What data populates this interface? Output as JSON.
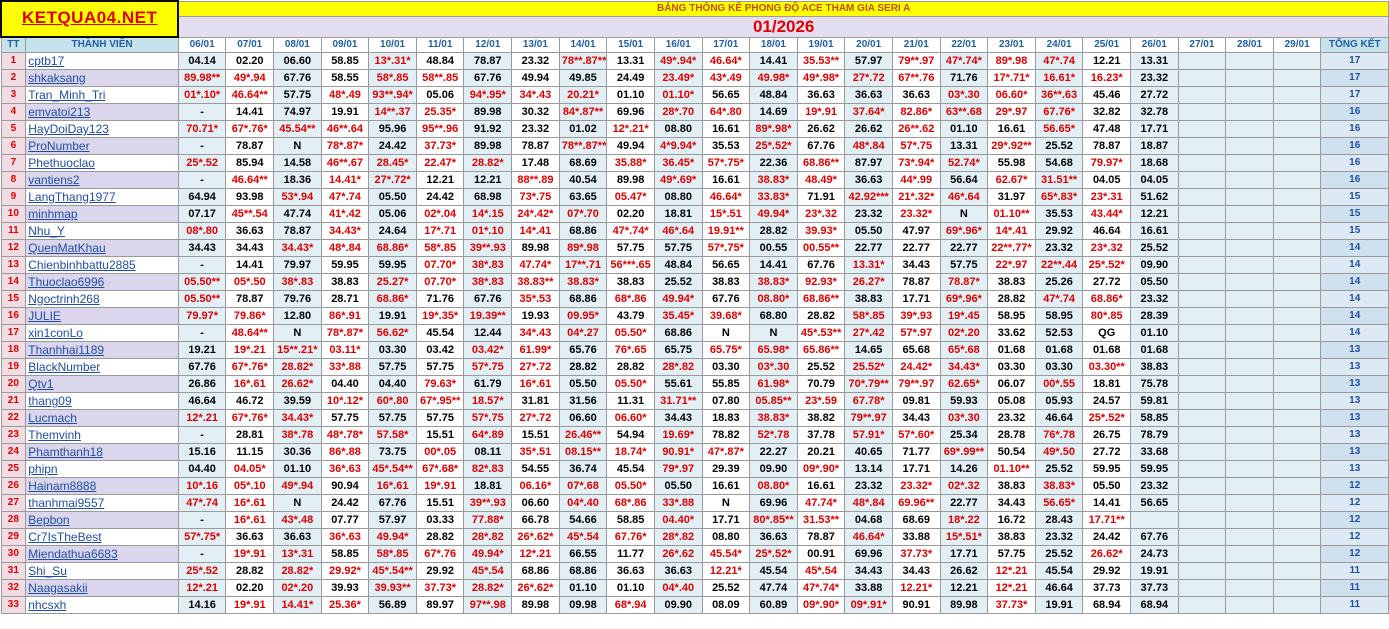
{
  "logo": "KETQUA04.NET",
  "banner": "BẢNG THỐNG KÊ PHONG ĐỘ ACE THAM GIA SERI A",
  "month": "01/2026",
  "headers": {
    "tt": "TT",
    "member": "THÀNH VIÊN",
    "dates": [
      "06/01",
      "07/01",
      "08/01",
      "09/01",
      "10/01",
      "11/01",
      "12/01",
      "13/01",
      "14/01",
      "15/01",
      "16/01",
      "17/01",
      "18/01",
      "19/01",
      "20/01",
      "21/01",
      "22/01",
      "23/01",
      "24/01",
      "25/01",
      "26/01",
      "27/01",
      "28/01",
      "29/01"
    ],
    "total": "TỔNG KẾT"
  },
  "rows": [
    {
      "tt": "1",
      "name": "cptb17",
      "cells": [
        "04.14",
        "02.20",
        "06.60",
        "58.85",
        "13*.31*",
        "48.84",
        "78.87",
        "23.32",
        "78**.87**",
        "13.31",
        "49*.94*",
        "46.64*",
        "14.41",
        "35.53**",
        "57.97",
        "79**.97",
        "47*.74*",
        "89*.98",
        "47*.74",
        "12.21",
        "13.31"
      ],
      "total": "17"
    },
    {
      "tt": "2",
      "name": "shkaksang",
      "cells": [
        "89.98**",
        "49*.94",
        "67.76",
        "58.55",
        "58*.85",
        "58**.85",
        "67.76",
        "49.94",
        "49.85",
        "24.49",
        "23.49*",
        "43*.49",
        "49.98*",
        "49*.98*",
        "27*.72",
        "67**.76",
        "71.76",
        "17*.71*",
        "16.61*",
        "16.23*",
        "23.32"
      ],
      "total": "17"
    },
    {
      "tt": "3",
      "name": "Tran_Minh_Tri",
      "cells": [
        "01*.10*",
        "46.64**",
        "57.75",
        "48*.49",
        "93**.94*",
        "05.06",
        "94*.95*",
        "34*.43",
        "20.21*",
        "01.10",
        "01.10*",
        "56.65",
        "48.84",
        "36.63",
        "36.63",
        "36.63",
        "03*.30",
        "06.60*",
        "36**.63",
        "45.46",
        "27.72"
      ],
      "total": "17"
    },
    {
      "tt": "4",
      "name": "emvatoi213",
      "cells": [
        "-",
        "14.41",
        "74.97",
        "19.91",
        "14**.37",
        "25.35*",
        "89.98",
        "30.32",
        "84*.87**",
        "69.96",
        "28*.70",
        "64*.80",
        "14.69",
        "19*.91",
        "37.64*",
        "82.86*",
        "63**.68",
        "29*.97",
        "67.76*",
        "32.82",
        "32.78"
      ],
      "total": "16"
    },
    {
      "tt": "5",
      "name": "HayDoiDay123",
      "cells": [
        "70.71*",
        "67*.76*",
        "45.54**",
        "46**.64",
        "95.96",
        "95**.96",
        "91.92",
        "23.32",
        "01.02",
        "12*.21*",
        "08.80",
        "16.61",
        "89*.98*",
        "26.62",
        "26.62",
        "26**.62",
        "01.10",
        "16.61",
        "56.65*",
        "47.48",
        "17.71"
      ],
      "total": "16"
    },
    {
      "tt": "6",
      "name": "ProNumber",
      "cells": [
        "-",
        "78.87",
        "N",
        "78*.87*",
        "24.42",
        "37.73*",
        "89.98",
        "78.87",
        "78**.87**",
        "49.94",
        "4*9.94*",
        "35.53",
        "25*.52*",
        "67.76",
        "48*.84",
        "57*.75",
        "13.31",
        "29*.92**",
        "25.52",
        "78.87",
        "18.87"
      ],
      "total": "16"
    },
    {
      "tt": "7",
      "name": "Phethuoclao",
      "cells": [
        "25*.52",
        "85.94",
        "14.58",
        "46**.67",
        "28.45*",
        "22.47*",
        "28.82*",
        "17.48",
        "68.69",
        "35.88*",
        "36.45*",
        "57*.75*",
        "22.36",
        "68.86**",
        "87.97",
        "73*.94*",
        "52.74*",
        "55.98",
        "54.68",
        "79.97*",
        "18.68"
      ],
      "total": "16"
    },
    {
      "tt": "8",
      "name": "vantiens2",
      "cells": [
        "-",
        "46.64**",
        "18.36",
        "14.41*",
        "27*.72*",
        "12.21",
        "12.21",
        "88**.89",
        "40.54",
        "89.98",
        "49*.69*",
        "16.61",
        "38.83*",
        "48.49*",
        "36.63",
        "44*.99",
        "56.64",
        "62.67*",
        "31.51**",
        "04.05",
        "04.05"
      ],
      "total": "16"
    },
    {
      "tt": "9",
      "name": "LangThang1977",
      "cells": [
        "64.94",
        "93.98",
        "53*.94",
        "47*.74",
        "05.50",
        "24.42",
        "68.98",
        "73*.75",
        "63.65",
        "05.47*",
        "08.80",
        "46.64*",
        "33.83*",
        "71.91",
        "42.92***",
        "21*.32*",
        "46*.64",
        "31.97",
        "65*.83*",
        "23*.31",
        "51.62"
      ],
      "total": "15"
    },
    {
      "tt": "10",
      "name": "minhmap",
      "cells": [
        "07.17",
        "45**.54",
        "47.74",
        "41*.42",
        "05.06",
        "02*.04",
        "14*.15",
        "24*.42*",
        "07*.70",
        "02.20",
        "18.81",
        "15*.51",
        "49.94*",
        "23*.32",
        "23.32",
        "23.32*",
        "N",
        "01.10**",
        "35.53",
        "43.44*",
        "12.21"
      ],
      "total": "15"
    },
    {
      "tt": "11",
      "name": "Nhu_Y",
      "cells": [
        "08*.80",
        "36.63",
        "78.87",
        "34.43*",
        "24.64",
        "17*.71",
        "01*.10",
        "14*.41",
        "68.86",
        "47*.74*",
        "46*.64",
        "19.91**",
        "28.82",
        "39.93*",
        "05.50",
        "47.97",
        "69*.96*",
        "14*.41",
        "29.92",
        "46.64",
        "16.61"
      ],
      "total": "15"
    },
    {
      "tt": "12",
      "name": "QuenMatKhau",
      "cells": [
        "34.43",
        "34.43",
        "34.43*",
        "48*.84",
        "68.86*",
        "58*.85",
        "39**.93",
        "89.98",
        "89*.98",
        "57.75",
        "57.75",
        "57*.75*",
        "00.55",
        "00.55**",
        "22.77",
        "22.77",
        "22.77",
        "22**.77*",
        "23.32",
        "23*.32",
        "25.52"
      ],
      "total": "14"
    },
    {
      "tt": "13",
      "name": "Chienbinhbattu2885",
      "cells": [
        "-",
        "14.41",
        "79.97",
        "59.95",
        "59.95",
        "07.70*",
        "38*.83",
        "47.74*",
        "17**.71",
        "56***.65",
        "48.84",
        "56.65",
        "14.41",
        "67.76",
        "13.31*",
        "34.43",
        "57.75",
        "22*.97",
        "22**.44",
        "25*.52*",
        "09.90"
      ],
      "total": "14"
    },
    {
      "tt": "14",
      "name": "Thuoclao6996",
      "cells": [
        "05.50**",
        "05*.50",
        "38*.83",
        "38.83",
        "25.27*",
        "07.70*",
        "38*.83",
        "38.83**",
        "38.83*",
        "38.83",
        "25.52",
        "38.83",
        "38.83*",
        "92.93*",
        "26.27*",
        "78.87",
        "78.87*",
        "38.83",
        "25.26",
        "27.72",
        "05.50"
      ],
      "total": "14"
    },
    {
      "tt": "15",
      "name": "Ngoctrinh268",
      "cells": [
        "05.50**",
        "78.87",
        "79.76",
        "28.71",
        "68.86*",
        "71.76",
        "67.76",
        "35*.53",
        "68.86",
        "68*.86",
        "49.94*",
        "67.76",
        "08.80*",
        "68.86**",
        "38.83",
        "17.71",
        "69*.96*",
        "28.82",
        "47*.74",
        "68.86*",
        "23.32"
      ],
      "total": "14"
    },
    {
      "tt": "16",
      "name": "JULIE",
      "cells": [
        "79.97*",
        "79.86*",
        "12.80",
        "86*.91",
        "19.91",
        "19*.35*",
        "19.39**",
        "19.93",
        "09.95*",
        "43.79",
        "35.45*",
        "39.68*",
        "68.80",
        "28.82",
        "58*.85",
        "39*.93",
        "19*.45",
        "58.95",
        "58.95",
        "80*.85",
        "28.39"
      ],
      "total": "14"
    },
    {
      "tt": "17",
      "name": "xin1conLo",
      "cells": [
        "-",
        "48.64**",
        "N",
        "78*.87*",
        "56.62*",
        "45.54",
        "12.44",
        "34*.43",
        "04*.27",
        "05.50*",
        "68.86",
        "N",
        "N",
        "45*.53**",
        "27*.42",
        "57*.97",
        "02*.20",
        "33.62",
        "52.53",
        "QG",
        "01.10"
      ],
      "total": "14"
    },
    {
      "tt": "18",
      "name": "Thanhhai1189",
      "cells": [
        "19.21",
        "19*.21",
        "15**.21*",
        "03.11*",
        "03.30",
        "03.42",
        "03.42*",
        "61.99*",
        "65.76",
        "76*.65",
        "65.75",
        "65.75*",
        "65.98*",
        "65.86**",
        "14.65",
        "65.68",
        "65*.68",
        "01.68",
        "01.68",
        "01.68",
        "01.68"
      ],
      "total": "13"
    },
    {
      "tt": "19",
      "name": "BlackNumber",
      "cells": [
        "67.76",
        "67*.76*",
        "28.82*",
        "33*.88",
        "57.75",
        "57.75",
        "57*.75",
        "27*.72",
        "28.82",
        "28.82",
        "28*.82",
        "03.30",
        "03*.30",
        "25.52",
        "25.52*",
        "24.42*",
        "34.43*",
        "03.30",
        "03.30",
        "03.30**",
        "38.83"
      ],
      "total": "13"
    },
    {
      "tt": "20",
      "name": "Qtv1",
      "cells": [
        "26.86",
        "16*.61",
        "26.62*",
        "04.40",
        "04.40",
        "79.63*",
        "61.79",
        "16*.61",
        "05.50",
        "05.50*",
        "55.61",
        "55.85",
        "61.98*",
        "70.79",
        "70*.79**",
        "79**.97",
        "62.65*",
        "06.07",
        "00*.55",
        "18.81",
        "75.78"
      ],
      "total": "13"
    },
    {
      "tt": "21",
      "name": "thang09",
      "cells": [
        "46.64",
        "46.72",
        "39.59",
        "10*.12*",
        "60*.80",
        "67*.95**",
        "18.57*",
        "31.81",
        "31.56",
        "11.31",
        "31.71**",
        "07.80",
        "05.85**",
        "23*.59",
        "67.78*",
        "09.81",
        "59.93",
        "05.08",
        "05.93",
        "24.57",
        "59.81"
      ],
      "total": "13"
    },
    {
      "tt": "22",
      "name": "Lucmach",
      "cells": [
        "12*.21",
        "67*.76*",
        "34.43*",
        "57.75",
        "57.75",
        "57.75",
        "57*.75",
        "27*.72",
        "06.60",
        "06.60*",
        "34.43",
        "18.83",
        "38.83*",
        "38.82",
        "79**.97",
        "34.43",
        "03*.30",
        "23.32",
        "46.64",
        "25*.52*",
        "58.85"
      ],
      "total": "13"
    },
    {
      "tt": "23",
      "name": "Themvinh",
      "cells": [
        "-",
        "28.81",
        "38*.78",
        "48*.78*",
        "57.58*",
        "15.51",
        "64*.89",
        "15.51",
        "26.46**",
        "54.94",
        "19.69*",
        "78.82",
        "52*.78",
        "37.78",
        "57.91*",
        "57*.60*",
        "25.34",
        "28.78",
        "76*.78",
        "26.75",
        "78.79"
      ],
      "total": "13"
    },
    {
      "tt": "24",
      "name": "Phamthanh18",
      "cells": [
        "15.16",
        "11.15",
        "30.36",
        "86*.88",
        "73.75",
        "00*.05",
        "08.11",
        "35*.51",
        "08.15**",
        "18.74*",
        "90.91*",
        "47*.87*",
        "22.27",
        "20.21",
        "40.65",
        "71.77",
        "69*.99**",
        "50.54",
        "49*.50",
        "27.72",
        "33.68"
      ],
      "total": "13"
    },
    {
      "tt": "25",
      "name": "phipn",
      "cells": [
        "04.40",
        "04.05*",
        "01.10",
        "36*.63",
        "45*.54**",
        "67*.68*",
        "82*.83",
        "54.55",
        "36.74",
        "45.54",
        "79*.97",
        "29.39",
        "09.90",
        "09*.90*",
        "13.14",
        "17.71",
        "14.26",
        "01.10**",
        "25.52",
        "59.95",
        "59.95"
      ],
      "total": "13"
    },
    {
      "tt": "26",
      "name": "Hainam8888",
      "cells": [
        "10*.16",
        "05*.10",
        "49*.94",
        "90.94",
        "16*.61",
        "19*.91",
        "18.81",
        "06.16*",
        "07*.68",
        "05.50*",
        "05.50",
        "16.61",
        "08.80*",
        "16.61",
        "23.32",
        "23.32*",
        "02*.32",
        "38.83",
        "38.83*",
        "05.50",
        "23.32"
      ],
      "total": "12"
    },
    {
      "tt": "27",
      "name": "thanhmai9557",
      "cells": [
        "47*.74",
        "16*.61",
        "N",
        "24.42",
        "67.76",
        "15.51",
        "39**.93",
        "06.60",
        "04*.40",
        "68*.86",
        "33*.88",
        "N",
        "69.96",
        "47.74*",
        "48*.84",
        "69.96**",
        "22.77",
        "34.43",
        "56.65*",
        "14.41",
        "56.65"
      ],
      "total": "12"
    },
    {
      "tt": "28",
      "name": "Bepbon",
      "cells": [
        "-",
        "16*.61",
        "43*.48",
        "07.77",
        "57.97",
        "03.33",
        "77.88*",
        "66.78",
        "54.66",
        "58.85",
        "04.40*",
        "17.71",
        "80*.85**",
        "31.53**",
        "04.68",
        "68.69",
        "18*.22",
        "16.72",
        "28.43",
        "17.71**",
        ""
      ],
      "total": "12"
    },
    {
      "tt": "29",
      "name": "Cr7IsTheBest",
      "cells": [
        "57*.75*",
        "36.63",
        "36.63",
        "36*.63",
        "49.94*",
        "28.82",
        "28*.82",
        "26*.62*",
        "45*.54",
        "67.76*",
        "28*.82",
        "08.80",
        "36.63",
        "78.87",
        "46.64*",
        "33.88",
        "15*.51*",
        "38.83",
        "23.32",
        "24.42",
        "67.76"
      ],
      "total": "12"
    },
    {
      "tt": "30",
      "name": "Miendathua6683",
      "cells": [
        "-",
        "19*.91",
        "13*.31",
        "58.85",
        "58*.85",
        "67*.76",
        "49.94*",
        "12*.21",
        "66.55",
        "11.77",
        "26*.62",
        "45.54*",
        "25*.52*",
        "00.91",
        "69.96",
        "37.73*",
        "17.71",
        "57.75",
        "25.52",
        "26.62*",
        "24.73"
      ],
      "total": "12"
    },
    {
      "tt": "31",
      "name": "Shi_Su",
      "cells": [
        "25*.52",
        "28.82",
        "28.82*",
        "29.92*",
        "45*.54**",
        "29.92",
        "45*.54",
        "68.86",
        "68.86",
        "36.63",
        "36.63",
        "12.21*",
        "45.54",
        "45*.54",
        "34.43",
        "34.43",
        "26.62",
        "12*.21",
        "45.54",
        "29.92",
        "19.91"
      ],
      "total": "11"
    },
    {
      "tt": "32",
      "name": "Naagasakii",
      "cells": [
        "12*.21",
        "02.20",
        "02*.20",
        "39.93",
        "39.93**",
        "37.73*",
        "28.82*",
        "26*.62*",
        "01.10",
        "01.10",
        "04*.40",
        "25.52",
        "47.74",
        "47*.74*",
        "33.88",
        "12.21*",
        "12.21",
        "12*.21",
        "46.64",
        "37.73",
        "37.73"
      ],
      "total": "11"
    },
    {
      "tt": "33",
      "name": "nhcsxh",
      "cells": [
        "14.16",
        "19*.91",
        "14.41*",
        "25.36*",
        "56.89",
        "89.97",
        "97**.98",
        "89.98",
        "09.98",
        "68*.94",
        "09.90",
        "08.09",
        "60.89",
        "09*.90*",
        "09*.91*",
        "90.91",
        "89.98",
        "37.73*",
        "19.91",
        "68.94",
        "68.94"
      ],
      "total": "11"
    }
  ]
}
